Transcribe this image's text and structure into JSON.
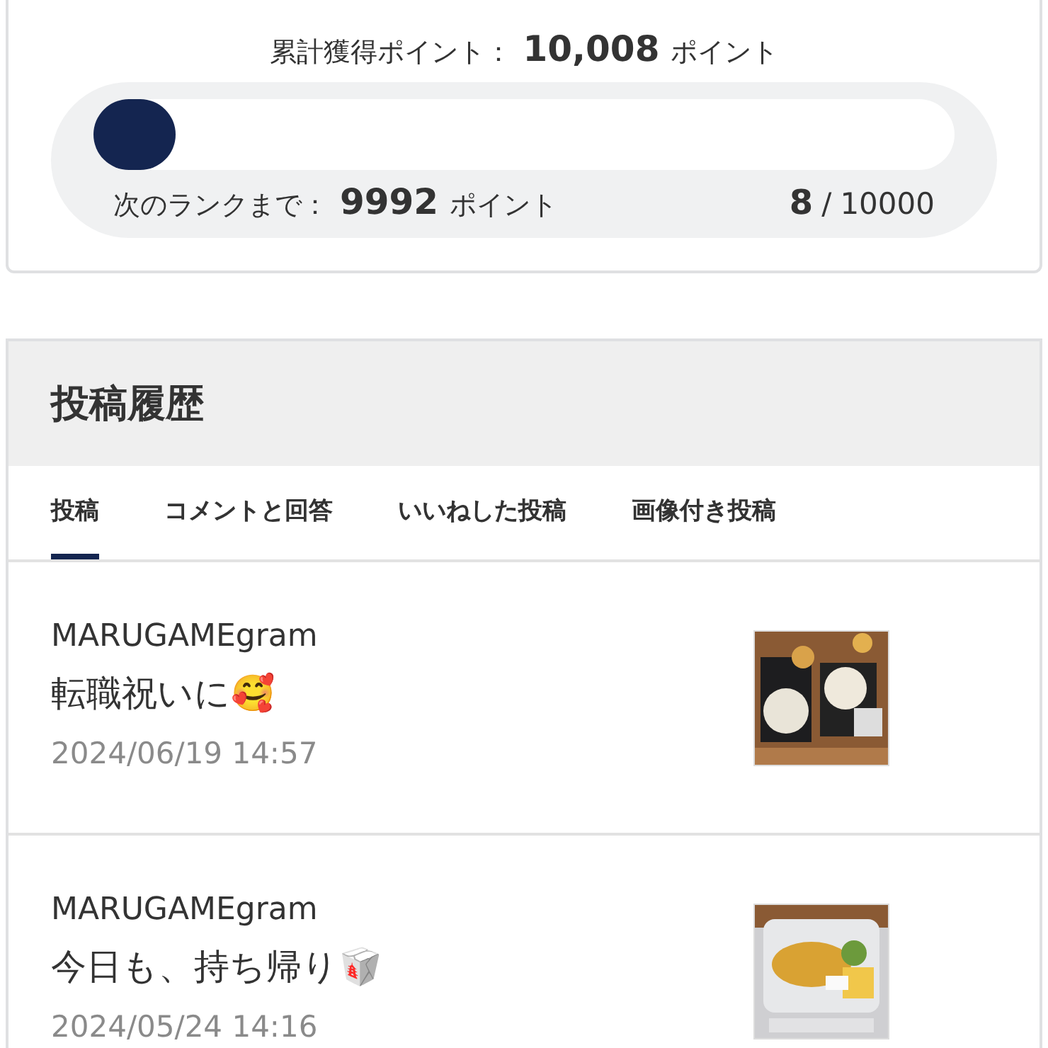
{
  "points": {
    "total_label": "累計獲得ポイント：",
    "total_value": "10,008",
    "total_unit": "ポイント",
    "level": 0.0008,
    "next_label": "次のランクまで：",
    "next_value": "9992",
    "next_unit": "ポイント",
    "current": "8",
    "separator": "/",
    "target": "10000"
  },
  "history": {
    "title": "投稿履歴",
    "tabs": [
      {
        "label": "投稿",
        "selected": true
      },
      {
        "label": "コメントと回答",
        "selected": false
      },
      {
        "label": "いいねした投稿",
        "selected": false
      },
      {
        "label": "画像付き投稿",
        "selected": false
      }
    ],
    "posts": [
      {
        "author": "MARUGAMEgram",
        "text": "転職祝いに🥰",
        "date": "2024/06/19 14:57"
      },
      {
        "author": "MARUGAMEgram",
        "text": "今日も、持ち帰り🥡",
        "date": "2024/05/24 14:16"
      }
    ]
  }
}
